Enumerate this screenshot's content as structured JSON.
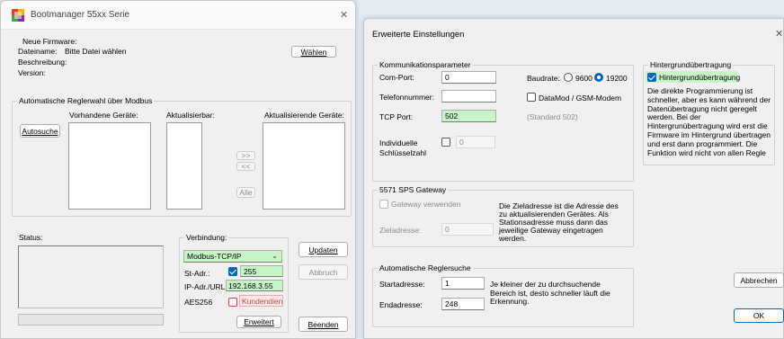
{
  "left_window": {
    "title": "Bootmanager 55xx Serie",
    "close_glyph": "✕",
    "neue_firmware": {
      "label": "Neue Firmware:",
      "dateiname_label": "Dateiname:",
      "dateiname_value": "Bitte Datei wählen",
      "beschreibung_label": "Beschreibung:",
      "version_label": "Version:",
      "waehlen_button": "Wählen"
    },
    "regler": {
      "label": "Automatische Reglerwahl über Modbus",
      "vorhandene_label": "Vorhandene Geräte:",
      "aktualisierbar_label": "Aktualisierbar:",
      "aktualisierende_label": "Aktualisierende Geräte:",
      "autosuche_button": "Autosuche",
      "move_right": ">>",
      "move_left": "<<",
      "alle_button": "Alle"
    },
    "status": {
      "label": "Status:"
    },
    "verbindung": {
      "label": "Verbindung:",
      "selected": "Modbus-TCP/IP",
      "st_adr_label": "St-Adr.:",
      "st_adr_value": "255",
      "ip_label": "IP-Adr./URL",
      "ip_value": "192.168.3.55",
      "aes_label": "AES256",
      "kundendienst_label": "Kundendienst",
      "erweitert_button": "Erweitert"
    },
    "updaten_button": "Updaten",
    "abbruch_button": "Abbruch",
    "beenden_button": "Beenden"
  },
  "right_window": {
    "title": "Erweiterte Einstellungen",
    "close_glyph": "✕",
    "kommunikation": {
      "label": "Kommunikationsparameter",
      "com_port_label": "Com-Port:",
      "com_port_value": "0",
      "baudrate_label": "Baudrate:",
      "baud_9600": "9600",
      "baud_19200": "19200",
      "telefon_label": "Telefonnummer:",
      "datamod_label": "DataMod / GSM-Modem",
      "tcp_port_label": "TCP Port:",
      "tcp_port_value": "502",
      "tcp_standard": "(Standard 502)",
      "individuelle_label_1": "Individuelle",
      "individuelle_label_2": "Schlüsselzahl",
      "schluessel_value": "0"
    },
    "hintergrund": {
      "label": "Hintergrundübertragung",
      "checkbox_label": "Hintergrundübertragung",
      "description": [
        "Die direkte Programmierung ist",
        "schneller, aber  es kann während der",
        "Datenübertragung nicht geregelt",
        "werden.  Bei der",
        "Hintergrunübertragung wird erst die",
        "Firmware im Hintergrund übertragen",
        "und erst dann programmiert. Die",
        "Funktion wird nicht von allen Regle"
      ]
    },
    "gateway": {
      "label": "5571 SPS Gateway",
      "checkbox_label": "Gateway verwenden",
      "zieladresse_label": "Zieladresse:",
      "zieladresse_value": "0",
      "description": [
        "Die Zieladresse ist die Adresse des",
        "zu aktualisierenden Gerätes. Als",
        "Stationsadresse muss dann das",
        "jeweilige Gateway eingetragen",
        "werden."
      ]
    },
    "reglersuche": {
      "label": "Automatische Reglersuche",
      "start_label": "Startadresse:",
      "start_value": "1",
      "end_label": "Endadresse:",
      "end_value": "248",
      "description": [
        "Je kleiner der zu durchsuchende",
        "Bereich ist, desto schneller läuft die",
        "Erkennung."
      ]
    },
    "abbrechen_button": "Abbrechen",
    "ok_button": "OK"
  },
  "colors": {
    "accent": "#0067c0",
    "highlight_green": "#c8f5c8",
    "warning_red": "#d04040"
  }
}
